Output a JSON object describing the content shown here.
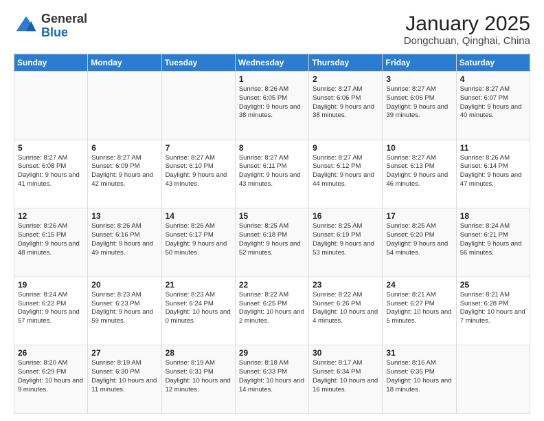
{
  "header": {
    "logo_general": "General",
    "logo_blue": "Blue",
    "title": "January 2025",
    "subtitle": "Dongchuan, Qinghai, China"
  },
  "days_of_week": [
    "Sunday",
    "Monday",
    "Tuesday",
    "Wednesday",
    "Thursday",
    "Friday",
    "Saturday"
  ],
  "weeks": [
    [
      {
        "day": "",
        "info": ""
      },
      {
        "day": "",
        "info": ""
      },
      {
        "day": "",
        "info": ""
      },
      {
        "day": "1",
        "info": "Sunrise: 8:26 AM\nSunset: 6:05 PM\nDaylight: 9 hours\nand 38 minutes."
      },
      {
        "day": "2",
        "info": "Sunrise: 8:27 AM\nSunset: 6:06 PM\nDaylight: 9 hours\nand 38 minutes."
      },
      {
        "day": "3",
        "info": "Sunrise: 8:27 AM\nSunset: 6:06 PM\nDaylight: 9 hours\nand 39 minutes."
      },
      {
        "day": "4",
        "info": "Sunrise: 8:27 AM\nSunset: 6:07 PM\nDaylight: 9 hours\nand 40 minutes."
      }
    ],
    [
      {
        "day": "5",
        "info": "Sunrise: 8:27 AM\nSunset: 6:08 PM\nDaylight: 9 hours\nand 41 minutes."
      },
      {
        "day": "6",
        "info": "Sunrise: 8:27 AM\nSunset: 6:09 PM\nDaylight: 9 hours\nand 42 minutes."
      },
      {
        "day": "7",
        "info": "Sunrise: 8:27 AM\nSunset: 6:10 PM\nDaylight: 9 hours\nand 43 minutes."
      },
      {
        "day": "8",
        "info": "Sunrise: 8:27 AM\nSunset: 6:11 PM\nDaylight: 9 hours\nand 43 minutes."
      },
      {
        "day": "9",
        "info": "Sunrise: 8:27 AM\nSunset: 6:12 PM\nDaylight: 9 hours\nand 44 minutes."
      },
      {
        "day": "10",
        "info": "Sunrise: 8:27 AM\nSunset: 6:13 PM\nDaylight: 9 hours\nand 46 minutes."
      },
      {
        "day": "11",
        "info": "Sunrise: 8:26 AM\nSunset: 6:14 PM\nDaylight: 9 hours\nand 47 minutes."
      }
    ],
    [
      {
        "day": "12",
        "info": "Sunrise: 8:26 AM\nSunset: 6:15 PM\nDaylight: 9 hours\nand 48 minutes."
      },
      {
        "day": "13",
        "info": "Sunrise: 8:26 AM\nSunset: 6:16 PM\nDaylight: 9 hours\nand 49 minutes."
      },
      {
        "day": "14",
        "info": "Sunrise: 8:26 AM\nSunset: 6:17 PM\nDaylight: 9 hours\nand 50 minutes."
      },
      {
        "day": "15",
        "info": "Sunrise: 8:25 AM\nSunset: 6:18 PM\nDaylight: 9 hours\nand 52 minutes."
      },
      {
        "day": "16",
        "info": "Sunrise: 8:25 AM\nSunset: 6:19 PM\nDaylight: 9 hours\nand 53 minutes."
      },
      {
        "day": "17",
        "info": "Sunrise: 8:25 AM\nSunset: 6:20 PM\nDaylight: 9 hours\nand 54 minutes."
      },
      {
        "day": "18",
        "info": "Sunrise: 8:24 AM\nSunset: 6:21 PM\nDaylight: 9 hours\nand 56 minutes."
      }
    ],
    [
      {
        "day": "19",
        "info": "Sunrise: 8:24 AM\nSunset: 6:22 PM\nDaylight: 9 hours\nand 57 minutes."
      },
      {
        "day": "20",
        "info": "Sunrise: 8:23 AM\nSunset: 6:23 PM\nDaylight: 9 hours\nand 59 minutes."
      },
      {
        "day": "21",
        "info": "Sunrise: 8:23 AM\nSunset: 6:24 PM\nDaylight: 10 hours\nand 0 minutes."
      },
      {
        "day": "22",
        "info": "Sunrise: 8:22 AM\nSunset: 6:25 PM\nDaylight: 10 hours\nand 2 minutes."
      },
      {
        "day": "23",
        "info": "Sunrise: 8:22 AM\nSunset: 6:26 PM\nDaylight: 10 hours\nand 4 minutes."
      },
      {
        "day": "24",
        "info": "Sunrise: 8:21 AM\nSunset: 6:27 PM\nDaylight: 10 hours\nand 5 minutes."
      },
      {
        "day": "25",
        "info": "Sunrise: 8:21 AM\nSunset: 6:28 PM\nDaylight: 10 hours\nand 7 minutes."
      }
    ],
    [
      {
        "day": "26",
        "info": "Sunrise: 8:20 AM\nSunset: 6:29 PM\nDaylight: 10 hours\nand 9 minutes."
      },
      {
        "day": "27",
        "info": "Sunrise: 8:19 AM\nSunset: 6:30 PM\nDaylight: 10 hours\nand 11 minutes."
      },
      {
        "day": "28",
        "info": "Sunrise: 8:19 AM\nSunset: 6:31 PM\nDaylight: 10 hours\nand 12 minutes."
      },
      {
        "day": "29",
        "info": "Sunrise: 8:18 AM\nSunset: 6:33 PM\nDaylight: 10 hours\nand 14 minutes."
      },
      {
        "day": "30",
        "info": "Sunrise: 8:17 AM\nSunset: 6:34 PM\nDaylight: 10 hours\nand 16 minutes."
      },
      {
        "day": "31",
        "info": "Sunrise: 8:16 AM\nSunset: 6:35 PM\nDaylight: 10 hours\nand 18 minutes."
      },
      {
        "day": "",
        "info": ""
      }
    ]
  ]
}
